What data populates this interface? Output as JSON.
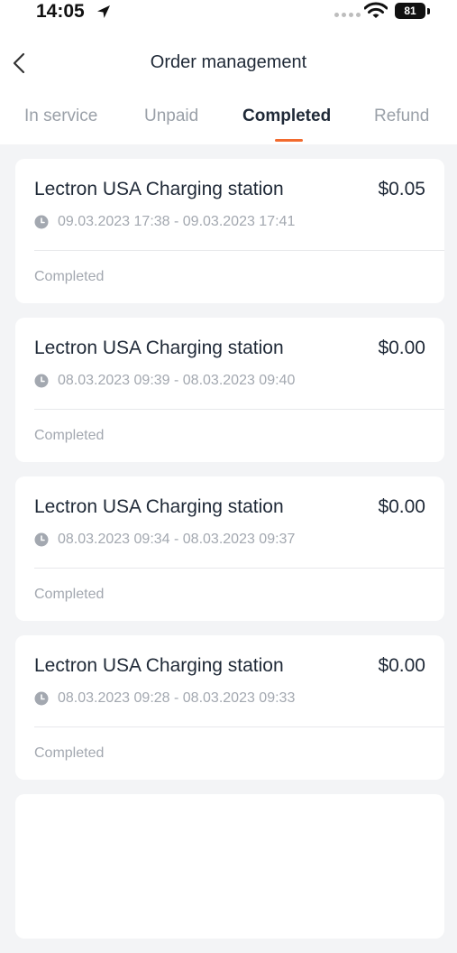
{
  "status_bar": {
    "time": "14:05",
    "battery": "81"
  },
  "header": {
    "title": "Order management"
  },
  "tabs": [
    {
      "label": "In service"
    },
    {
      "label": "Unpaid"
    },
    {
      "label": "Completed"
    },
    {
      "label": "Refund"
    }
  ],
  "active_tab": "Completed",
  "colors": {
    "accent": "#f26a2e",
    "background": "#f3f4f6",
    "muted_text": "#a3a8b0"
  },
  "orders": [
    {
      "station": "Lectron USA Charging station",
      "price": "$0.05",
      "time": "09.03.2023 17:38 - 09.03.2023 17:41",
      "status": "Completed"
    },
    {
      "station": "Lectron USA Charging station",
      "price": "$0.00",
      "time": "08.03.2023 09:39 - 08.03.2023 09:40",
      "status": "Completed"
    },
    {
      "station": "Lectron USA Charging station",
      "price": "$0.00",
      "time": "08.03.2023 09:34 - 08.03.2023 09:37",
      "status": "Completed"
    },
    {
      "station": "Lectron USA Charging station",
      "price": "$0.00",
      "time": "08.03.2023 09:28 - 08.03.2023 09:33",
      "status": "Completed"
    }
  ]
}
